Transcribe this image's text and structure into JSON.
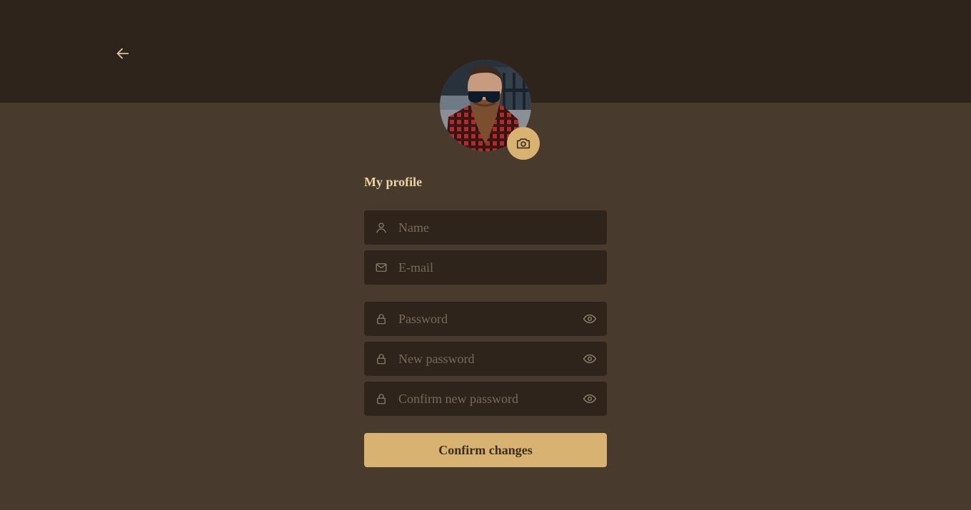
{
  "header": {
    "back_icon": "arrow-left-icon"
  },
  "profile": {
    "title": "My profile",
    "avatar_alt": "profile photo",
    "camera_icon": "camera-icon"
  },
  "form": {
    "name": {
      "placeholder": "Name",
      "value": "",
      "icon": "user-icon"
    },
    "email": {
      "placeholder": "E-mail",
      "value": "",
      "icon": "mail-icon"
    },
    "password": {
      "placeholder": "Password",
      "value": "",
      "icon": "lock-icon",
      "toggle_icon": "eye-icon"
    },
    "new_password": {
      "placeholder": "New password",
      "value": "",
      "icon": "lock-icon",
      "toggle_icon": "eye-icon"
    },
    "confirm_password": {
      "placeholder": "Confirm new password",
      "value": "",
      "icon": "lock-icon",
      "toggle_icon": "eye-icon"
    },
    "submit_label": "Confirm changes"
  },
  "colors": {
    "background": "#483a2d",
    "header": "#2f241c",
    "field": "#2f241c",
    "accent": "#d8b270",
    "title": "#ecd3a3",
    "placeholder": "#77695a"
  }
}
